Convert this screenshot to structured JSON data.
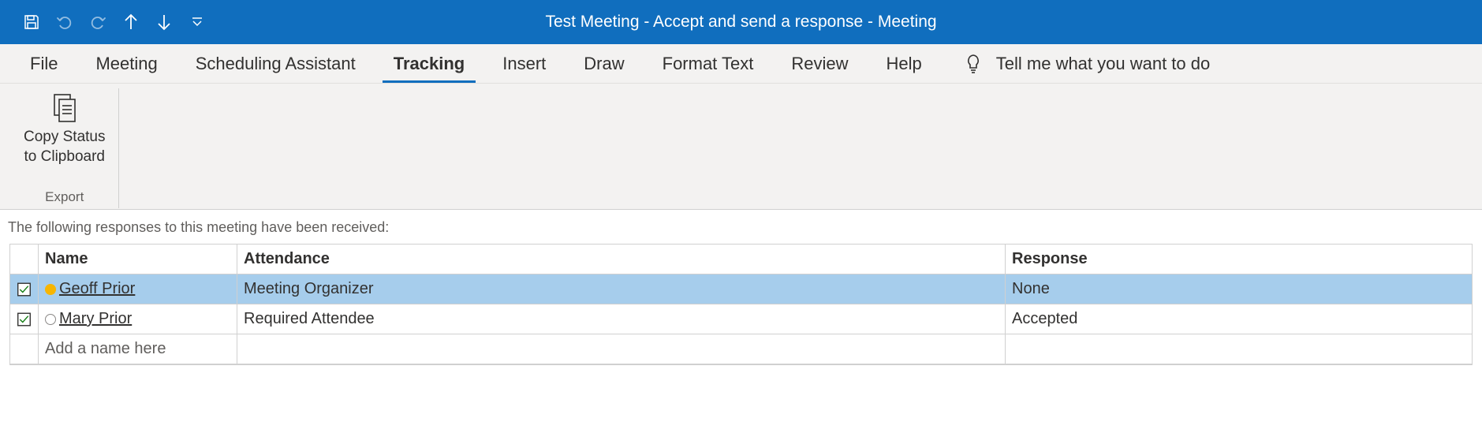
{
  "window_title": "Test Meeting - Accept and send a response  -  Meeting",
  "tabs": {
    "file": "File",
    "meeting": "Meeting",
    "scheduling": "Scheduling Assistant",
    "tracking": "Tracking",
    "insert": "Insert",
    "draw": "Draw",
    "format": "Format Text",
    "review": "Review",
    "help": "Help"
  },
  "tell_me": "Tell me what you want to do",
  "ribbon": {
    "copy_status": "Copy Status\nto Clipboard",
    "group_export": "Export"
  },
  "tracking": {
    "intro": "The following responses to this meeting have been received:",
    "headers": {
      "name": "Name",
      "attendance": "Attendance",
      "response": "Response"
    },
    "rows": [
      {
        "name": "Geoff Prior",
        "attendance": "Meeting Organizer",
        "response": "None",
        "selected": true,
        "type": "organizer"
      },
      {
        "name": "Mary Prior",
        "attendance": "Required Attendee",
        "response": "Accepted",
        "selected": false,
        "type": "attendee"
      }
    ],
    "add_placeholder": "Add a name here"
  }
}
